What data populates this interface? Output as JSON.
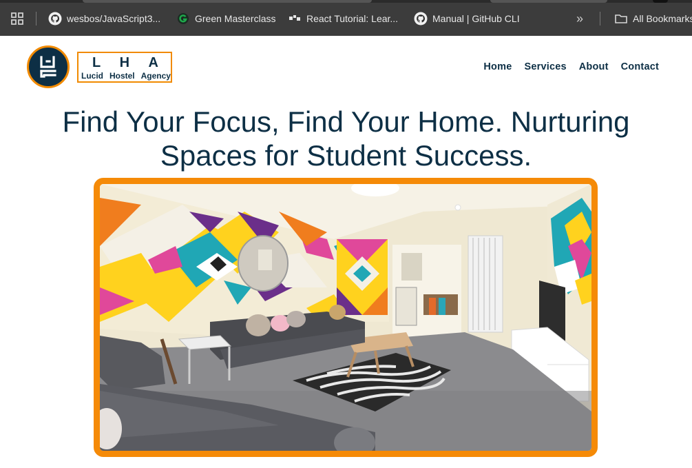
{
  "bookmarks": {
    "items": [
      {
        "label": "wesbos/JavaScript3...",
        "icon": "github-icon"
      },
      {
        "label": "Green Masterclass",
        "icon": "green-g-icon"
      },
      {
        "label": "React Tutorial: Lear...",
        "icon": "react-icon"
      },
      {
        "label": "Manual | GitHub CLI",
        "icon": "github-icon"
      }
    ],
    "overflow": "»",
    "all_bookmarks": "All Bookmarks"
  },
  "logo": {
    "letters": [
      "L",
      "H",
      "A"
    ],
    "words": [
      "Lucid",
      "Hostel",
      "Agency"
    ]
  },
  "nav": {
    "items": [
      "Home",
      "Services",
      "About",
      "Contact"
    ]
  },
  "hero": {
    "headline": "Find Your Focus, Find Your Home. Nurturing Spaces for Student Success."
  },
  "colors": {
    "brand_navy": "#0d2f45",
    "accent_orange": "#f58a07",
    "chrome_bar": "#3c3c3c"
  }
}
